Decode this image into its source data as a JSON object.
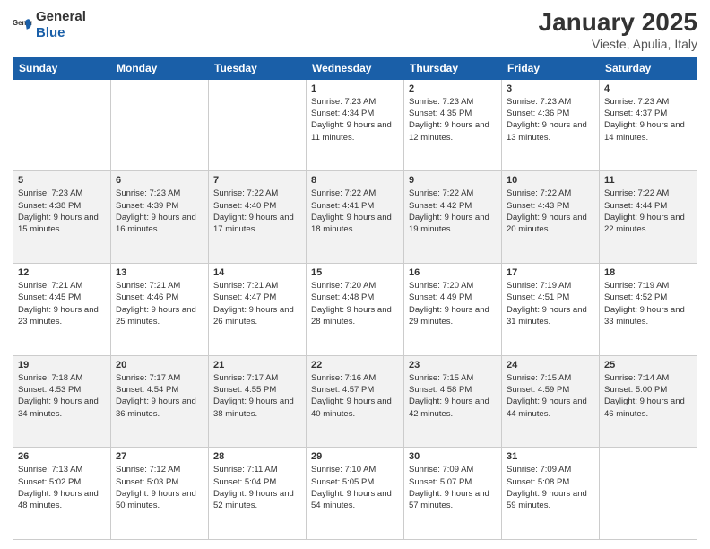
{
  "header": {
    "logo_general": "General",
    "logo_blue": "Blue",
    "title": "January 2025",
    "subtitle": "Vieste, Apulia, Italy"
  },
  "weekdays": [
    "Sunday",
    "Monday",
    "Tuesday",
    "Wednesday",
    "Thursday",
    "Friday",
    "Saturday"
  ],
  "weeks": [
    [
      {
        "day": "",
        "sunrise": "",
        "sunset": "",
        "daylight": ""
      },
      {
        "day": "",
        "sunrise": "",
        "sunset": "",
        "daylight": ""
      },
      {
        "day": "",
        "sunrise": "",
        "sunset": "",
        "daylight": ""
      },
      {
        "day": "1",
        "sunrise": "Sunrise: 7:23 AM",
        "sunset": "Sunset: 4:34 PM",
        "daylight": "Daylight: 9 hours and 11 minutes."
      },
      {
        "day": "2",
        "sunrise": "Sunrise: 7:23 AM",
        "sunset": "Sunset: 4:35 PM",
        "daylight": "Daylight: 9 hours and 12 minutes."
      },
      {
        "day": "3",
        "sunrise": "Sunrise: 7:23 AM",
        "sunset": "Sunset: 4:36 PM",
        "daylight": "Daylight: 9 hours and 13 minutes."
      },
      {
        "day": "4",
        "sunrise": "Sunrise: 7:23 AM",
        "sunset": "Sunset: 4:37 PM",
        "daylight": "Daylight: 9 hours and 14 minutes."
      }
    ],
    [
      {
        "day": "5",
        "sunrise": "Sunrise: 7:23 AM",
        "sunset": "Sunset: 4:38 PM",
        "daylight": "Daylight: 9 hours and 15 minutes."
      },
      {
        "day": "6",
        "sunrise": "Sunrise: 7:23 AM",
        "sunset": "Sunset: 4:39 PM",
        "daylight": "Daylight: 9 hours and 16 minutes."
      },
      {
        "day": "7",
        "sunrise": "Sunrise: 7:22 AM",
        "sunset": "Sunset: 4:40 PM",
        "daylight": "Daylight: 9 hours and 17 minutes."
      },
      {
        "day": "8",
        "sunrise": "Sunrise: 7:22 AM",
        "sunset": "Sunset: 4:41 PM",
        "daylight": "Daylight: 9 hours and 18 minutes."
      },
      {
        "day": "9",
        "sunrise": "Sunrise: 7:22 AM",
        "sunset": "Sunset: 4:42 PM",
        "daylight": "Daylight: 9 hours and 19 minutes."
      },
      {
        "day": "10",
        "sunrise": "Sunrise: 7:22 AM",
        "sunset": "Sunset: 4:43 PM",
        "daylight": "Daylight: 9 hours and 20 minutes."
      },
      {
        "day": "11",
        "sunrise": "Sunrise: 7:22 AM",
        "sunset": "Sunset: 4:44 PM",
        "daylight": "Daylight: 9 hours and 22 minutes."
      }
    ],
    [
      {
        "day": "12",
        "sunrise": "Sunrise: 7:21 AM",
        "sunset": "Sunset: 4:45 PM",
        "daylight": "Daylight: 9 hours and 23 minutes."
      },
      {
        "day": "13",
        "sunrise": "Sunrise: 7:21 AM",
        "sunset": "Sunset: 4:46 PM",
        "daylight": "Daylight: 9 hours and 25 minutes."
      },
      {
        "day": "14",
        "sunrise": "Sunrise: 7:21 AM",
        "sunset": "Sunset: 4:47 PM",
        "daylight": "Daylight: 9 hours and 26 minutes."
      },
      {
        "day": "15",
        "sunrise": "Sunrise: 7:20 AM",
        "sunset": "Sunset: 4:48 PM",
        "daylight": "Daylight: 9 hours and 28 minutes."
      },
      {
        "day": "16",
        "sunrise": "Sunrise: 7:20 AM",
        "sunset": "Sunset: 4:49 PM",
        "daylight": "Daylight: 9 hours and 29 minutes."
      },
      {
        "day": "17",
        "sunrise": "Sunrise: 7:19 AM",
        "sunset": "Sunset: 4:51 PM",
        "daylight": "Daylight: 9 hours and 31 minutes."
      },
      {
        "day": "18",
        "sunrise": "Sunrise: 7:19 AM",
        "sunset": "Sunset: 4:52 PM",
        "daylight": "Daylight: 9 hours and 33 minutes."
      }
    ],
    [
      {
        "day": "19",
        "sunrise": "Sunrise: 7:18 AM",
        "sunset": "Sunset: 4:53 PM",
        "daylight": "Daylight: 9 hours and 34 minutes."
      },
      {
        "day": "20",
        "sunrise": "Sunrise: 7:17 AM",
        "sunset": "Sunset: 4:54 PM",
        "daylight": "Daylight: 9 hours and 36 minutes."
      },
      {
        "day": "21",
        "sunrise": "Sunrise: 7:17 AM",
        "sunset": "Sunset: 4:55 PM",
        "daylight": "Daylight: 9 hours and 38 minutes."
      },
      {
        "day": "22",
        "sunrise": "Sunrise: 7:16 AM",
        "sunset": "Sunset: 4:57 PM",
        "daylight": "Daylight: 9 hours and 40 minutes."
      },
      {
        "day": "23",
        "sunrise": "Sunrise: 7:15 AM",
        "sunset": "Sunset: 4:58 PM",
        "daylight": "Daylight: 9 hours and 42 minutes."
      },
      {
        "day": "24",
        "sunrise": "Sunrise: 7:15 AM",
        "sunset": "Sunset: 4:59 PM",
        "daylight": "Daylight: 9 hours and 44 minutes."
      },
      {
        "day": "25",
        "sunrise": "Sunrise: 7:14 AM",
        "sunset": "Sunset: 5:00 PM",
        "daylight": "Daylight: 9 hours and 46 minutes."
      }
    ],
    [
      {
        "day": "26",
        "sunrise": "Sunrise: 7:13 AM",
        "sunset": "Sunset: 5:02 PM",
        "daylight": "Daylight: 9 hours and 48 minutes."
      },
      {
        "day": "27",
        "sunrise": "Sunrise: 7:12 AM",
        "sunset": "Sunset: 5:03 PM",
        "daylight": "Daylight: 9 hours and 50 minutes."
      },
      {
        "day": "28",
        "sunrise": "Sunrise: 7:11 AM",
        "sunset": "Sunset: 5:04 PM",
        "daylight": "Daylight: 9 hours and 52 minutes."
      },
      {
        "day": "29",
        "sunrise": "Sunrise: 7:10 AM",
        "sunset": "Sunset: 5:05 PM",
        "daylight": "Daylight: 9 hours and 54 minutes."
      },
      {
        "day": "30",
        "sunrise": "Sunrise: 7:09 AM",
        "sunset": "Sunset: 5:07 PM",
        "daylight": "Daylight: 9 hours and 57 minutes."
      },
      {
        "day": "31",
        "sunrise": "Sunrise: 7:09 AM",
        "sunset": "Sunset: 5:08 PM",
        "daylight": "Daylight: 9 hours and 59 minutes."
      },
      {
        "day": "",
        "sunrise": "",
        "sunset": "",
        "daylight": ""
      }
    ]
  ]
}
